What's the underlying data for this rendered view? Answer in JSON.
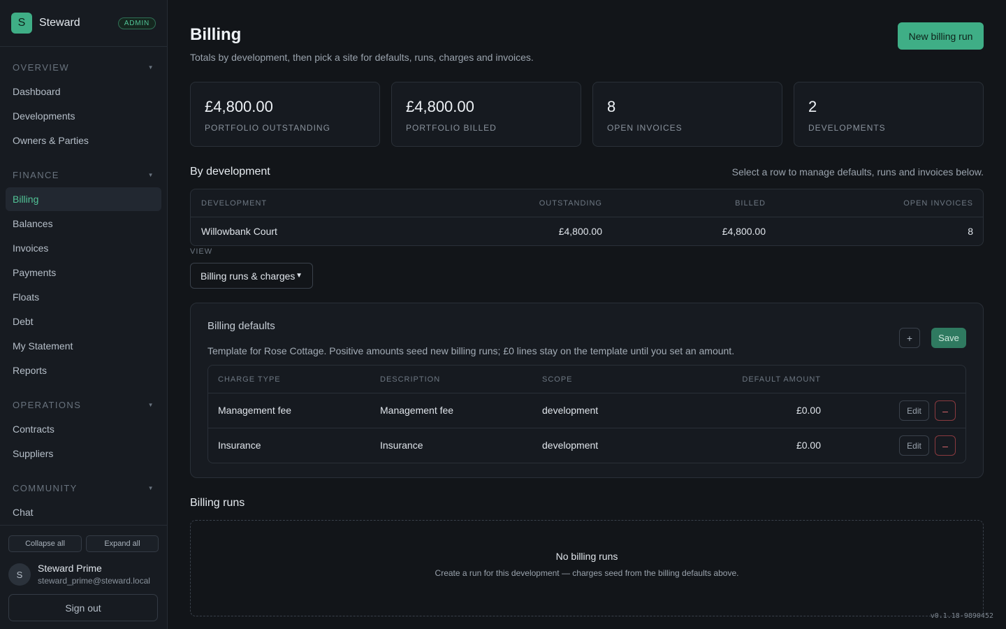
{
  "brand": {
    "logo_letter": "S",
    "name": "Steward",
    "role_badge": "ADMIN",
    "accent": "#3fae86"
  },
  "sidebar": {
    "sections": [
      {
        "title": "OVERVIEW",
        "items": [
          "Dashboard",
          "Developments",
          "Owners & Parties"
        ]
      },
      {
        "title": "FINANCE",
        "items": [
          "Billing",
          "Balances",
          "Invoices",
          "Payments",
          "Floats",
          "Debt",
          "My Statement",
          "Reports"
        ]
      },
      {
        "title": "OPERATIONS",
        "items": [
          "Contracts",
          "Suppliers"
        ]
      },
      {
        "title": "COMMUNITY",
        "items": [
          "Chat"
        ]
      }
    ],
    "active_item": "Billing",
    "collapse_all": "Collapse all",
    "expand_all": "Expand all",
    "user": {
      "initial": "S",
      "name": "Steward Prime",
      "email": "steward_prime@steward.local"
    },
    "sign_out": "Sign out"
  },
  "page": {
    "title": "Billing",
    "subtitle": "Totals by development, then pick a site for defaults, runs, charges and invoices.",
    "new_run_button": "New billing run"
  },
  "stats": [
    {
      "value": "£4,800.00",
      "label": "PORTFOLIO OUTSTANDING"
    },
    {
      "value": "£4,800.00",
      "label": "PORTFOLIO BILLED"
    },
    {
      "value": "8",
      "label": "OPEN INVOICES"
    },
    {
      "value": "2",
      "label": "DEVELOPMENTS"
    }
  ],
  "by_development": {
    "heading": "By development",
    "hint": "Select a row to manage defaults, runs and invoices below.",
    "columns": [
      "DEVELOPMENT",
      "OUTSTANDING",
      "BILLED",
      "OPEN INVOICES"
    ],
    "rows": [
      {
        "development": "Willowbank Court",
        "outstanding": "£4,800.00",
        "billed": "£4,800.00",
        "open_invoices": "8"
      }
    ]
  },
  "view": {
    "label": "VIEW",
    "selected": "Billing runs & charges"
  },
  "billing_defaults": {
    "title": "Billing defaults",
    "description": "Template for Rose Cottage. Positive amounts seed new billing runs; £0 lines stay on the template until you set an amount.",
    "add_label": "+",
    "save_label": "Save",
    "columns": [
      "CHARGE TYPE",
      "DESCRIPTION",
      "SCOPE",
      "DEFAULT AMOUNT"
    ],
    "rows": [
      {
        "charge_type": "Management fee",
        "description": "Management fee",
        "scope": "development",
        "amount": "£0.00",
        "edit": "Edit",
        "remove": "–"
      },
      {
        "charge_type": "Insurance",
        "description": "Insurance",
        "scope": "development",
        "amount": "£0.00",
        "edit": "Edit",
        "remove": "–"
      }
    ]
  },
  "billing_runs": {
    "heading": "Billing runs",
    "empty_title": "No billing runs",
    "empty_sub": "Create a run for this development — charges seed from the billing defaults above."
  },
  "version": "v0.1.18-9890452"
}
